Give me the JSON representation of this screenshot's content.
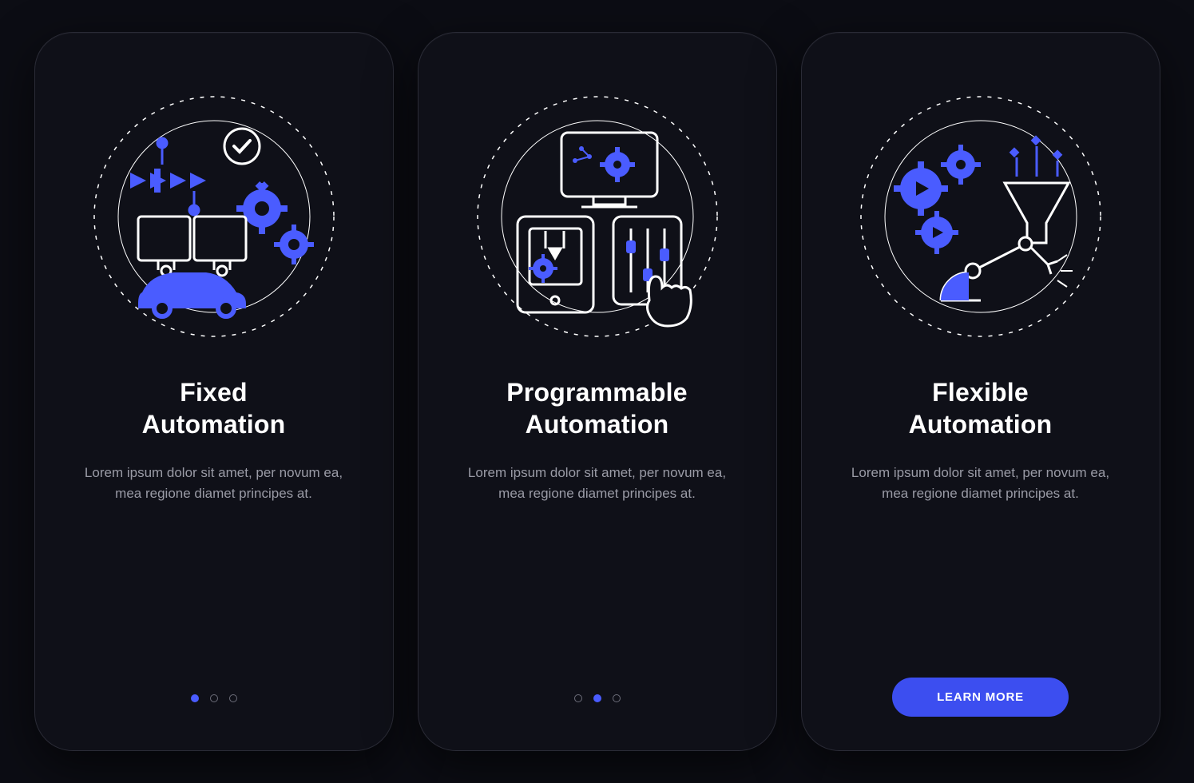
{
  "colors": {
    "accent": "#3c4ef0",
    "accentLight": "#4a5cff",
    "bg": "#0c0d14"
  },
  "cards": [
    {
      "title": "Fixed\nAutomation",
      "desc": "Lorem ipsum dolor sit amet, per novum ea, mea regione diamet principes at.",
      "activeDot": 0
    },
    {
      "title": "Programmable\nAutomation",
      "desc": "Lorem ipsum dolor sit amet, per novum ea, mea regione diamet principes at.",
      "activeDot": 1
    },
    {
      "title": "Flexible\nAutomation",
      "desc": "Lorem ipsum dolor sit amet, per novum ea, mea regione diamet principes at.",
      "cta": "LEARN MORE"
    }
  ]
}
